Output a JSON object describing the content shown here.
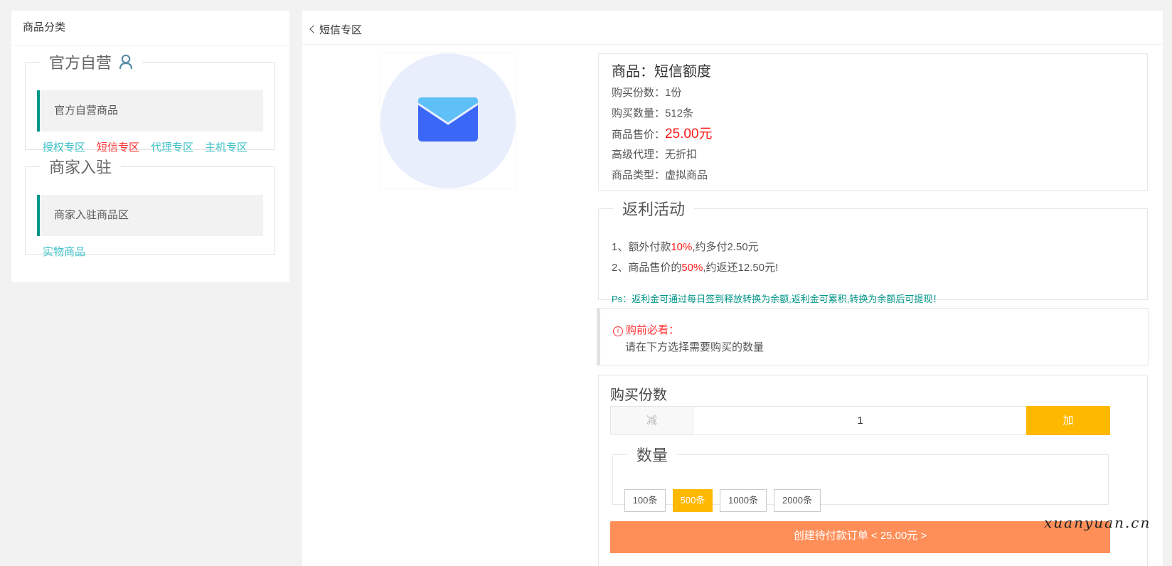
{
  "left": {
    "title": "商品分类",
    "groups": [
      {
        "legend": "官方自营",
        "item": "官方自营商品",
        "links": [
          "授权专区",
          "短信专区",
          "代理专区",
          "主机专区"
        ]
      },
      {
        "legend": "商家入驻",
        "item": "商家入驻商品区",
        "links": [
          "实物商品"
        ]
      }
    ]
  },
  "header": {
    "back_label": "短信专区"
  },
  "product": {
    "title": "商品：短信额度",
    "rows": [
      {
        "label": "购买份数：",
        "value": "1份"
      },
      {
        "label": "购买数量：",
        "value": "512条"
      },
      {
        "label": "商品售价：",
        "value": "25.00元"
      },
      {
        "label": "高级代理：",
        "value": "无折扣"
      },
      {
        "label": "商品类型：",
        "value": "虚拟商品"
      }
    ]
  },
  "rebate": {
    "legend": "返利活动",
    "line1": {
      "pre": "1、额外付款",
      "pct": "10%",
      "post": ",约多付2.50元"
    },
    "line2": {
      "pre": "2、商品售价的",
      "pct": "50%",
      "post": ",约返还12.50元!"
    },
    "note": "Ps：返利金可通过每日签到释放转换为余额,返利金可累积,转换为余额后可提现！"
  },
  "notice": {
    "title": "购前必看：",
    "text": "请在下方选择需要购买的数量"
  },
  "purchase": {
    "title": "购买份数",
    "minus": "减",
    "quantity": "1",
    "plus": "加",
    "qty_legend": "数量",
    "options": [
      "100条",
      "500条",
      "1000条",
      "2000条"
    ],
    "selected": "500条",
    "submit": "创建待付款订单 < 25.00元 >"
  },
  "colors": {
    "accent": "#009688",
    "link": "#3ec1c8",
    "price": "#ff1a1a",
    "warn": "#ffb800",
    "submit": "#ff8f59"
  },
  "watermark": "xuanyuan.cn"
}
